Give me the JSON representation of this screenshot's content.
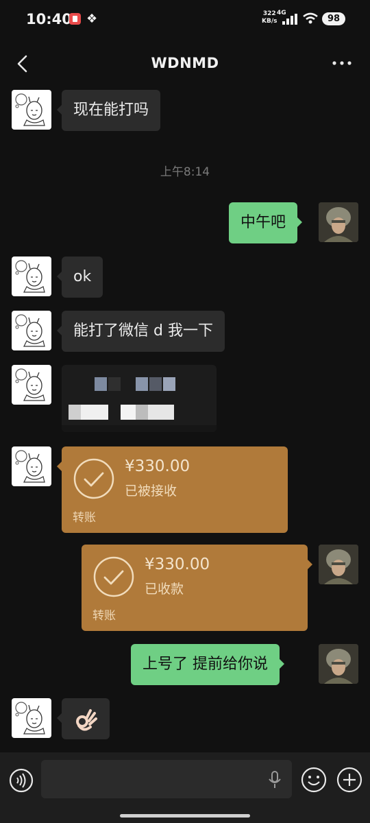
{
  "status_bar": {
    "time": "10:40",
    "net_speed": "322",
    "net_unit": "KB/s",
    "network": "4G",
    "battery": "98"
  },
  "header": {
    "title": "WDNMD",
    "back_icon": "chevron-left-icon",
    "more_icon": "more-dots-icon"
  },
  "messages": {
    "m1": "现在能打吗",
    "timestamp": "上午8:14",
    "m2": "中午吧",
    "m3": "ok",
    "m4": "能打了微信 d 我一下",
    "m6_transfer": {
      "amount": "¥330.00",
      "status": "已被接收",
      "label": "转账"
    },
    "m7_transfer": {
      "amount": "¥330.00",
      "status": "已收款",
      "label": "转账"
    },
    "m8": "上号了 提前给你说",
    "m9_emoji": "ok-hand-emoji"
  },
  "colors": {
    "background": "#111111",
    "incoming_bubble": "#2c2c2c",
    "outgoing_bubble": "#6fcf84",
    "transfer_card": "#b07a3a"
  },
  "input_bar": {
    "voice_icon": "voice-icon",
    "mic_icon": "mic-icon",
    "emoji_icon": "emoji-icon",
    "plus_icon": "plus-icon"
  }
}
